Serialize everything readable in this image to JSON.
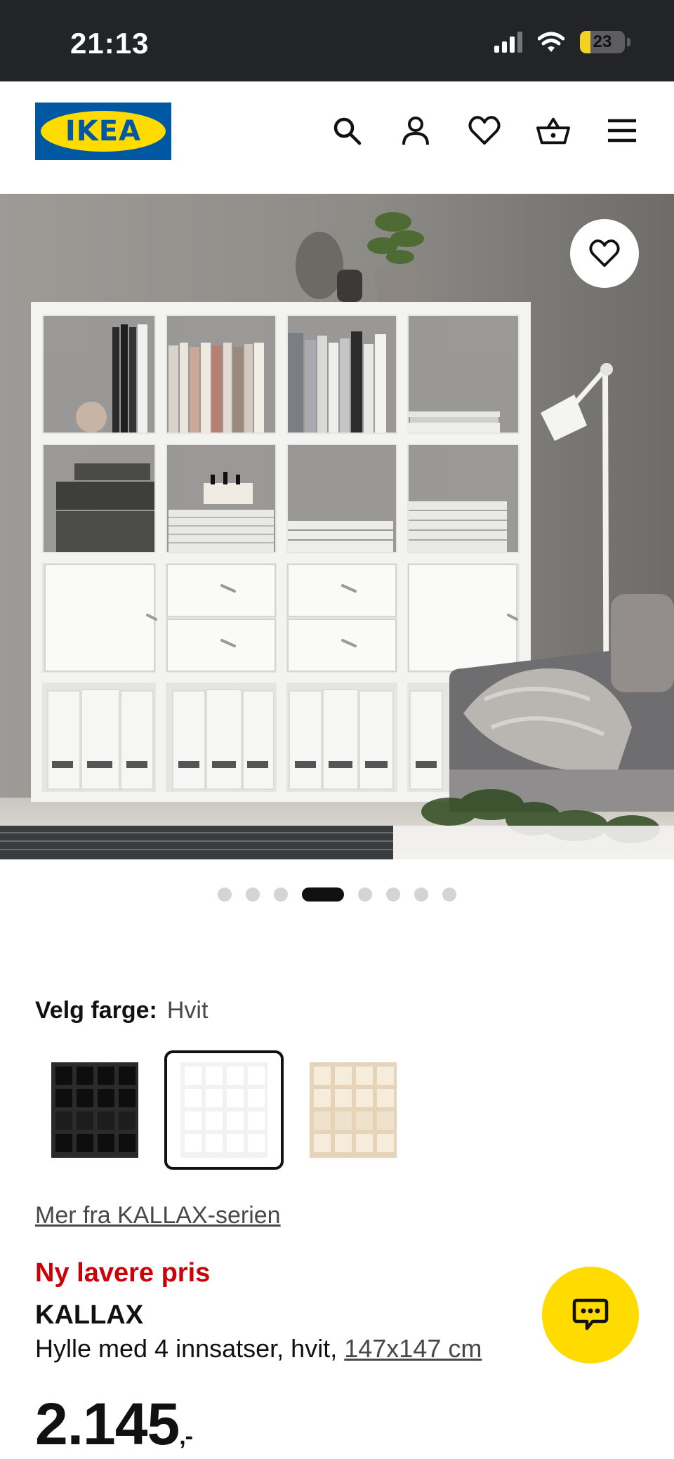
{
  "status_bar": {
    "time": "21:13",
    "battery_level": "23",
    "battery_fraction": 0.23
  },
  "header": {
    "logo_text": "IKEA",
    "icons": [
      "search-icon",
      "user-icon",
      "heart-icon",
      "basket-icon",
      "menu-icon"
    ]
  },
  "carousel": {
    "total_images": 8,
    "active_index": 3
  },
  "color_picker": {
    "label": "Velg farge:",
    "selected": "Hvit",
    "options": [
      {
        "name": "black-brown",
        "frame": "#2b2b2b",
        "insert": "#1d1d1d"
      },
      {
        "name": "white",
        "frame": "#f2f2f2",
        "insert": "#ffffff"
      },
      {
        "name": "oak",
        "frame": "#e6d4b8",
        "insert": "#efe2cc"
      }
    ]
  },
  "series_link": "Mer fra KALLAX-serien",
  "product": {
    "badge": "Ny lavere pris",
    "name": "KALLAX",
    "description": "Hylle med 4 innsatser, hvit,",
    "dimensions": "147x147 cm",
    "price": "2.145",
    "price_suffix": ",-"
  },
  "colors": {
    "brand_blue": "#0058a3",
    "brand_yellow": "#ffdb00",
    "price_red": "#cc0008"
  }
}
